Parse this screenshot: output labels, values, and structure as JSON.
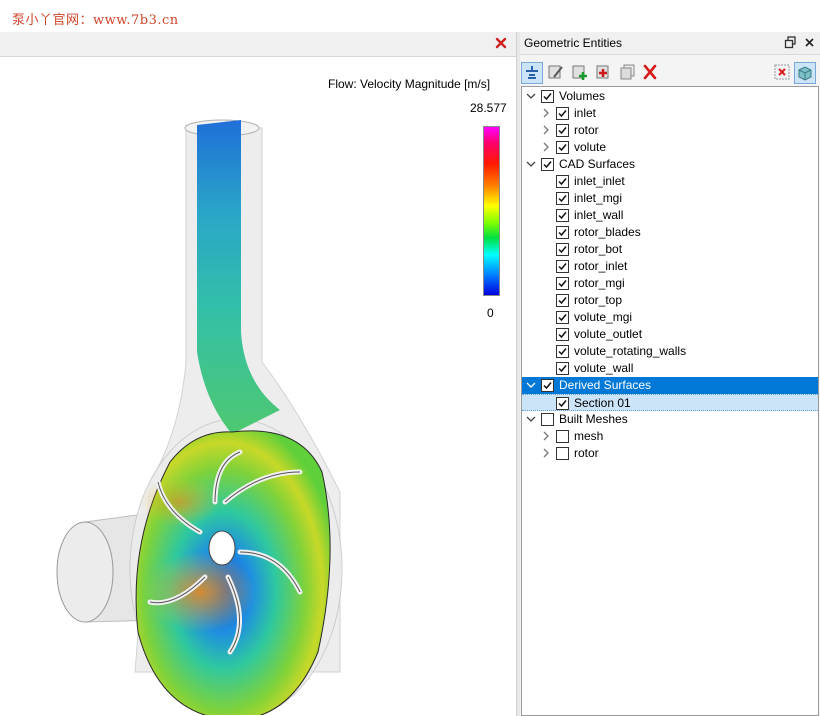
{
  "watermark": "泵小丫官网：www.7b3.cn",
  "viewport": {
    "legend_title": "Flow: Velocity Magnitude [m/s]",
    "legend_max": "28.577",
    "legend_min": "0"
  },
  "panel": {
    "title": "Geometric Entities",
    "restore_icon": "restore-icon",
    "close_icon": "close-icon"
  },
  "toolbar": {
    "buttons": [
      "filter-icon",
      "edit-surface-icon",
      "add-green-icon",
      "add-red-icon",
      "duplicate-icon",
      "delete-icon"
    ],
    "right_buttons": [
      "hide-icon",
      "show-3d-icon"
    ]
  },
  "tree": [
    {
      "label": "Volumes",
      "level": 0,
      "expanded": true,
      "checked": true
    },
    {
      "label": "inlet",
      "level": 1,
      "expandable": true,
      "checked": true
    },
    {
      "label": "rotor",
      "level": 1,
      "expandable": true,
      "checked": true
    },
    {
      "label": "volute",
      "level": 1,
      "expandable": true,
      "checked": true
    },
    {
      "label": "CAD Surfaces",
      "level": 0,
      "expanded": true,
      "checked": true
    },
    {
      "label": "inlet_inlet",
      "level": 1,
      "checked": true
    },
    {
      "label": "inlet_mgi",
      "level": 1,
      "checked": true
    },
    {
      "label": "inlet_wall",
      "level": 1,
      "checked": true
    },
    {
      "label": "rotor_blades",
      "level": 1,
      "checked": true
    },
    {
      "label": "rotor_bot",
      "level": 1,
      "checked": true
    },
    {
      "label": "rotor_inlet",
      "level": 1,
      "checked": true
    },
    {
      "label": "rotor_mgi",
      "level": 1,
      "checked": true
    },
    {
      "label": "rotor_top",
      "level": 1,
      "checked": true
    },
    {
      "label": "volute_mgi",
      "level": 1,
      "checked": true
    },
    {
      "label": "volute_outlet",
      "level": 1,
      "checked": true
    },
    {
      "label": "volute_rotating_walls",
      "level": 1,
      "checked": true
    },
    {
      "label": "volute_wall",
      "level": 1,
      "checked": true
    },
    {
      "label": "Derived Surfaces",
      "level": 0,
      "expanded": true,
      "checked": true,
      "selected": true
    },
    {
      "label": "Section 01",
      "level": 1,
      "checked": true,
      "selected": true
    },
    {
      "label": "Built Meshes",
      "level": 0,
      "expanded": true,
      "checked": false
    },
    {
      "label": "mesh",
      "level": 1,
      "expandable": true,
      "checked": false
    },
    {
      "label": "rotor",
      "level": 1,
      "expandable": true,
      "checked": false
    }
  ]
}
